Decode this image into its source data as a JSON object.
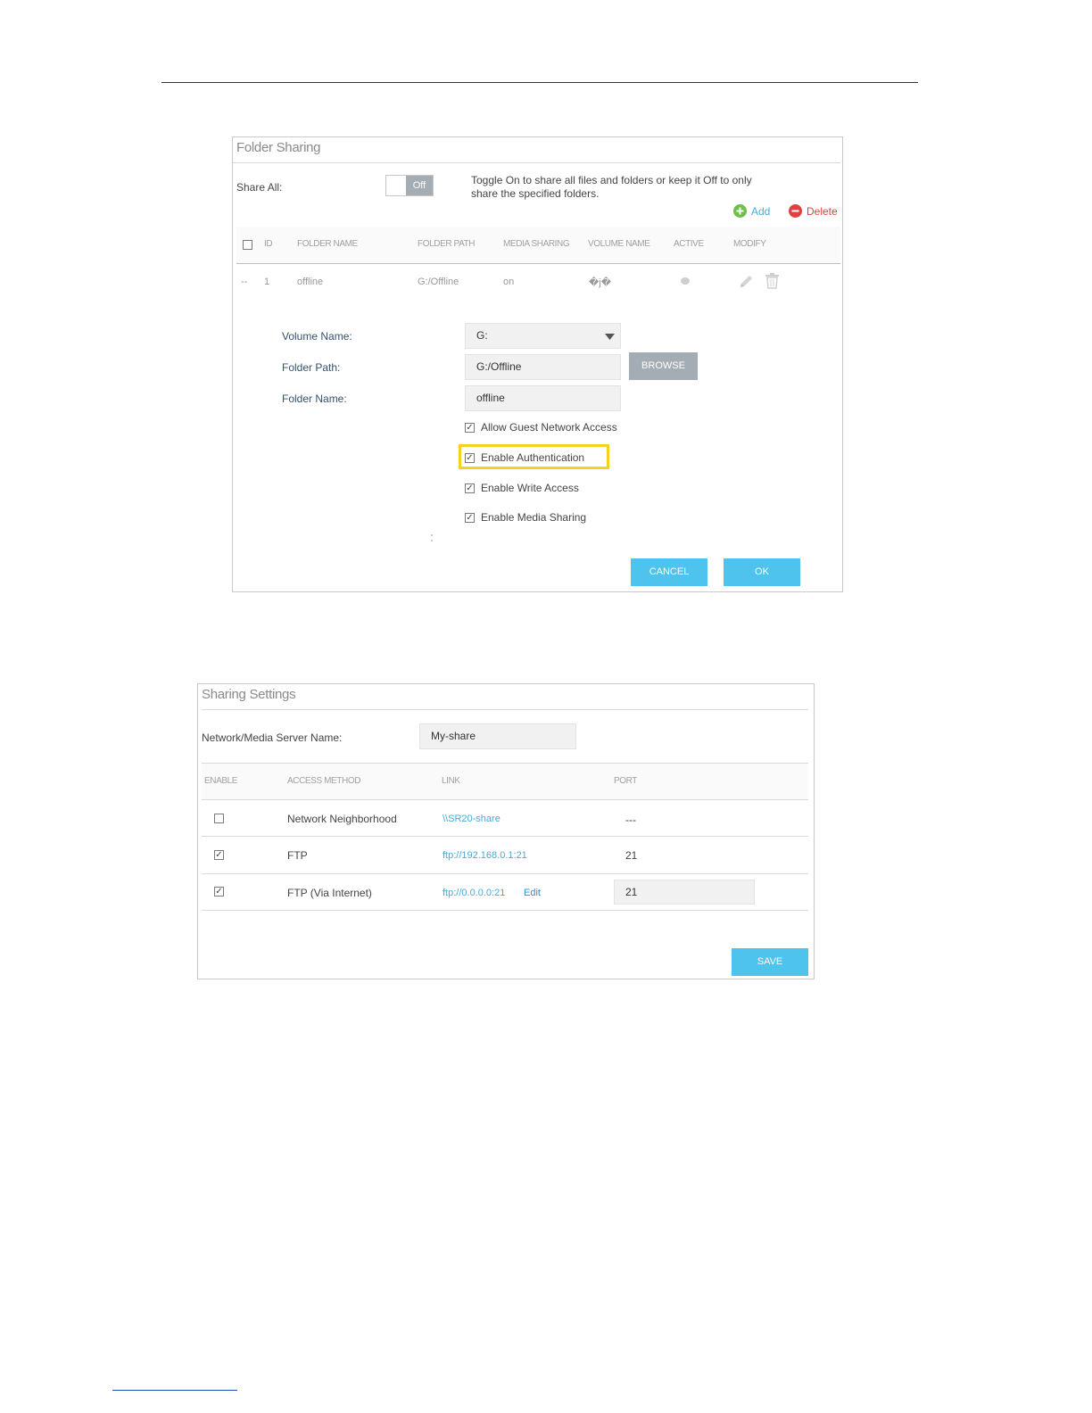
{
  "folder_sharing": {
    "title": "Folder Sharing",
    "share_all_label": "Share All:",
    "toggle_state": "Off",
    "toggle_hint_line1": "Toggle On to share all files and folders or keep it Off to only",
    "toggle_hint_line2": "share the specified folders.",
    "add_label": "Add",
    "delete_label": "Delete",
    "columns": [
      "ID",
      "FOLDER NAME",
      "FOLDER PATH",
      "MEDIA SHARING",
      "VOLUME NAME",
      "ACTIVE",
      "MODIFY"
    ],
    "row": {
      "marker": "--",
      "id": "1",
      "folder_name": "offline",
      "folder_path": "G:/Offline",
      "media_sharing": "on",
      "volume_name": "�j�"
    },
    "form": {
      "volume_name_label": "Volume Name:",
      "volume_name_value": "G:",
      "folder_path_label": "Folder Path:",
      "folder_path_value": "G:/Offline",
      "browse_label": "BROWSE",
      "folder_name_label": "Folder Name:",
      "folder_name_value": "offline",
      "options": [
        {
          "label": "Allow Guest Network Access",
          "checked": true
        },
        {
          "label": "Enable Authentication",
          "checked": true
        },
        {
          "label": "Enable Write Access",
          "checked": true
        },
        {
          "label": "Enable Media Sharing",
          "checked": true
        }
      ],
      "cancel_label": "CANCEL",
      "ok_label": "OK"
    }
  },
  "sharing_settings": {
    "title": "Sharing Settings",
    "server_name_label": "Network/Media Server Name:",
    "server_name_value": "My-share",
    "columns": [
      "ENABLE",
      "ACCESS METHOD",
      "LINK",
      "PORT"
    ],
    "rows": [
      {
        "enabled": false,
        "method": "Network Neighborhood",
        "link": "\\\\SR20-share",
        "port": "---"
      },
      {
        "enabled": true,
        "method": "FTP",
        "link": "ftp://192.168.0.1:21",
        "port": "21"
      },
      {
        "enabled": true,
        "method": "FTP (Via Internet)",
        "link": "ftp://0.0.0.0:21",
        "edit_label": "Edit",
        "port": "21"
      }
    ],
    "save_label": "SAVE"
  },
  "colors": {
    "accent_blue": "#4ec3ee",
    "highlight_yellow": "#f4d21f",
    "add_green": "#6cbf4a",
    "delete_red": "#e04040"
  }
}
